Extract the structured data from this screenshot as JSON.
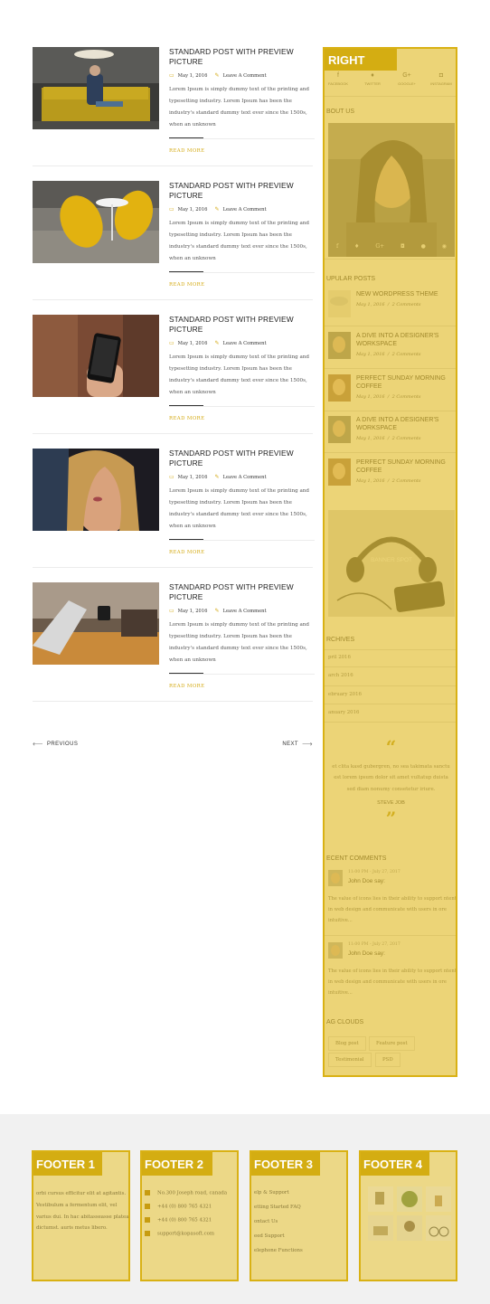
{
  "posts": [
    {
      "title": "STANDARD POST WITH PREVIEW PICTURE",
      "date": "May 1, 2016",
      "comments": "Leave A Comment",
      "excerpt": "Lorem Ipsum is simply dummy text of the printing and typesetting industry. Lorem Ipsum has been the industry's standard dummy text ever since the 1500s, when an unknown",
      "read_more": "READ MORE"
    },
    {
      "title": "STANDARD POST WITH PREVIEW PICTURE",
      "date": "May 1, 2016",
      "comments": "Leave A Comment",
      "excerpt": "Lorem Ipsum is simply dummy text of the printing and typesetting industry. Lorem Ipsum has been the industry's standard dummy text ever since the 1500s, when an unknown",
      "read_more": "READ MORE"
    },
    {
      "title": "STANDARD POST WITH PREVIEW PICTURE",
      "date": "May 1, 2016",
      "comments": "Leave A Comment",
      "excerpt": "Lorem Ipsum is simply dummy text of the printing and typesetting industry. Lorem Ipsum has been the industry's standard dummy text ever since the 1500s, when an unknown",
      "read_more": "READ MORE"
    },
    {
      "title": "STANDARD POST WITH PREVIEW PICTURE",
      "date": "May 1, 2016",
      "comments": "Leave A Comment",
      "excerpt": "Lorem Ipsum is simply dummy text of the printing and typesetting industry. Lorem Ipsum has been the industry's standard dummy text ever since the 1500s, when an unknown",
      "read_more": "READ MORE"
    },
    {
      "title": "STANDARD POST WITH PREVIEW PICTURE",
      "date": "May 1, 2016",
      "comments": "Leave A Comment",
      "excerpt": "Lorem Ipsum is simply dummy text of the printing and typesetting industry. Lorem Ipsum has been the industry's standard dummy text ever since the 1500s, when an unknown",
      "read_more": "READ MORE"
    }
  ],
  "pager": {
    "prev": "PREVIOUS",
    "next": "NEXT"
  },
  "sidebar": {
    "label": "RIGHT",
    "social": [
      "FACEBOOK",
      "TWITTER",
      "GOOGLE+",
      "INSTAGRAM"
    ],
    "about_title": "BOUT US",
    "popular_title": "UPULAR POSTS",
    "popular": [
      {
        "title": "NEW WORDPRESS THEME",
        "date": "May 1, 2016",
        "comments": "2 Comments"
      },
      {
        "title": "A DIVE INTO A DESIGNER'S WORKSPACE",
        "date": "May 1, 2016",
        "comments": "2 Comments"
      },
      {
        "title": "PERFECT SUNDAY MORNING COFFEE",
        "date": "May 1, 2016",
        "comments": "2 Comments"
      },
      {
        "title": "A DIVE INTO A DESIGNER'S WORKSPACE",
        "date": "May 1, 2016",
        "comments": "2 Comments"
      },
      {
        "title": "PERFECT SUNDAY MORNING COFFEE",
        "date": "May 1, 2016",
        "comments": "2 Comments"
      }
    ],
    "banner": "BANNER SPOT",
    "archives_title": "RCHIVES",
    "archives": [
      "pril 2016",
      "arch 2016",
      "ebruary 2016",
      "anuary 2016"
    ],
    "quote": [
      "et clita kasd gubergren, no sea takimata sanctu",
      "est lorem ipsum dolor sit amet vultatup duista",
      "sed diam nonumy consetetur iriure."
    ],
    "quote_author": "STEVE JOB",
    "comments_title": "ECENT COMMENTS",
    "comments": [
      {
        "date": "11:00 PM - July 27, 2017",
        "name": "John Doe say:",
        "text": "The value of icons lies in their ability to support ntent in web design and communicate with users in ore intuitive..."
      },
      {
        "date": "11:00 PM - July 27, 2017",
        "name": "John Doe say:",
        "text": "The value of icons lies in their ability to support ntent in web design and communicate with users in ore intuitive..."
      }
    ],
    "tags_title": "AG CLOUDS",
    "tags": [
      "Blog post",
      "Feature post",
      "Testimonial",
      "PSD"
    ]
  },
  "footer": {
    "labels": [
      "FOOTER 1",
      "FOOTER 2",
      "FOOTER 3",
      "FOOTER 4"
    ],
    "col1_text": "orbi cursus efficitur elit at agitantis. Vestibulum a fermentum elit, vel varius dui. In hac abitasseasse platea dictumst. auris metus libero.",
    "col2": [
      "No.300 Joseph road, canada",
      "+44 (0) 800 765 4321",
      "+44 (0) 800 765 4321",
      "support@kopasoft.com"
    ],
    "col3": [
      "elp & Support",
      "etting Started FAQ",
      "ontact Us",
      "eed Support",
      "elephone Functions"
    ]
  },
  "colors": {
    "accent": "#d4ad12",
    "overlay": "#e2be30"
  }
}
